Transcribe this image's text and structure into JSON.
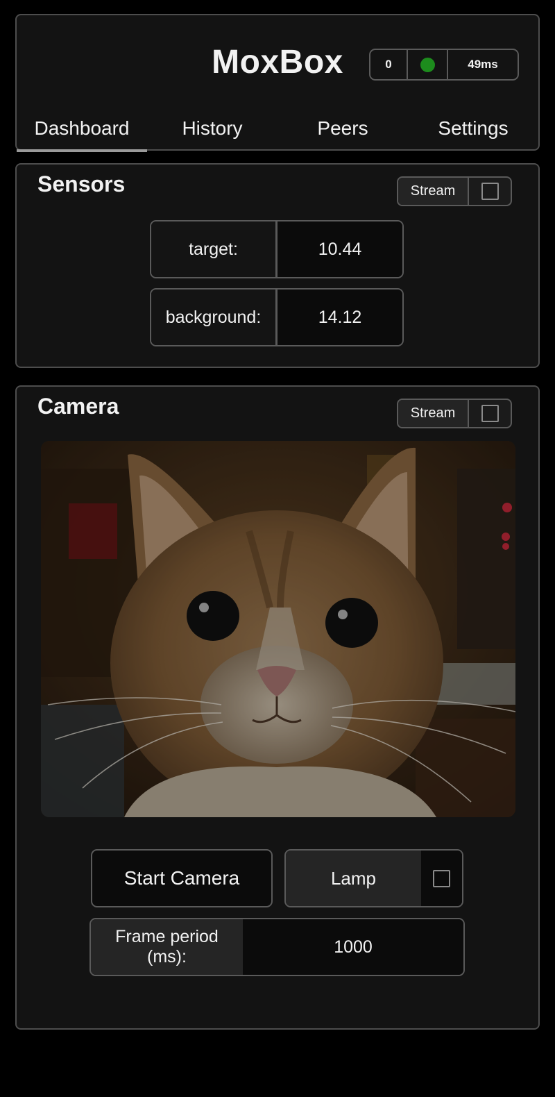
{
  "header": {
    "title": "MoxBox",
    "status": {
      "count": "0",
      "connection_color": "#1d8c1d",
      "connection_icon": "status-dot-icon",
      "latency": "49ms"
    },
    "tabs": [
      {
        "label": "Dashboard",
        "active": true
      },
      {
        "label": "History",
        "active": false
      },
      {
        "label": "Peers",
        "active": false
      },
      {
        "label": "Settings",
        "active": false
      }
    ]
  },
  "sensors": {
    "title": "Sensors",
    "stream_label": "Stream",
    "stream_checked": false,
    "rows": [
      {
        "key": "target:",
        "value": "10.44"
      },
      {
        "key": "background:",
        "value": "14.12"
      }
    ]
  },
  "camera": {
    "title": "Camera",
    "stream_label": "Stream",
    "stream_checked": false,
    "image": "camera-feed-cat",
    "start_button": "Start Camera",
    "lamp_label": "Lamp",
    "lamp_checked": false,
    "frame_period_label": "Frame period (ms):",
    "frame_period_value": "1000"
  }
}
